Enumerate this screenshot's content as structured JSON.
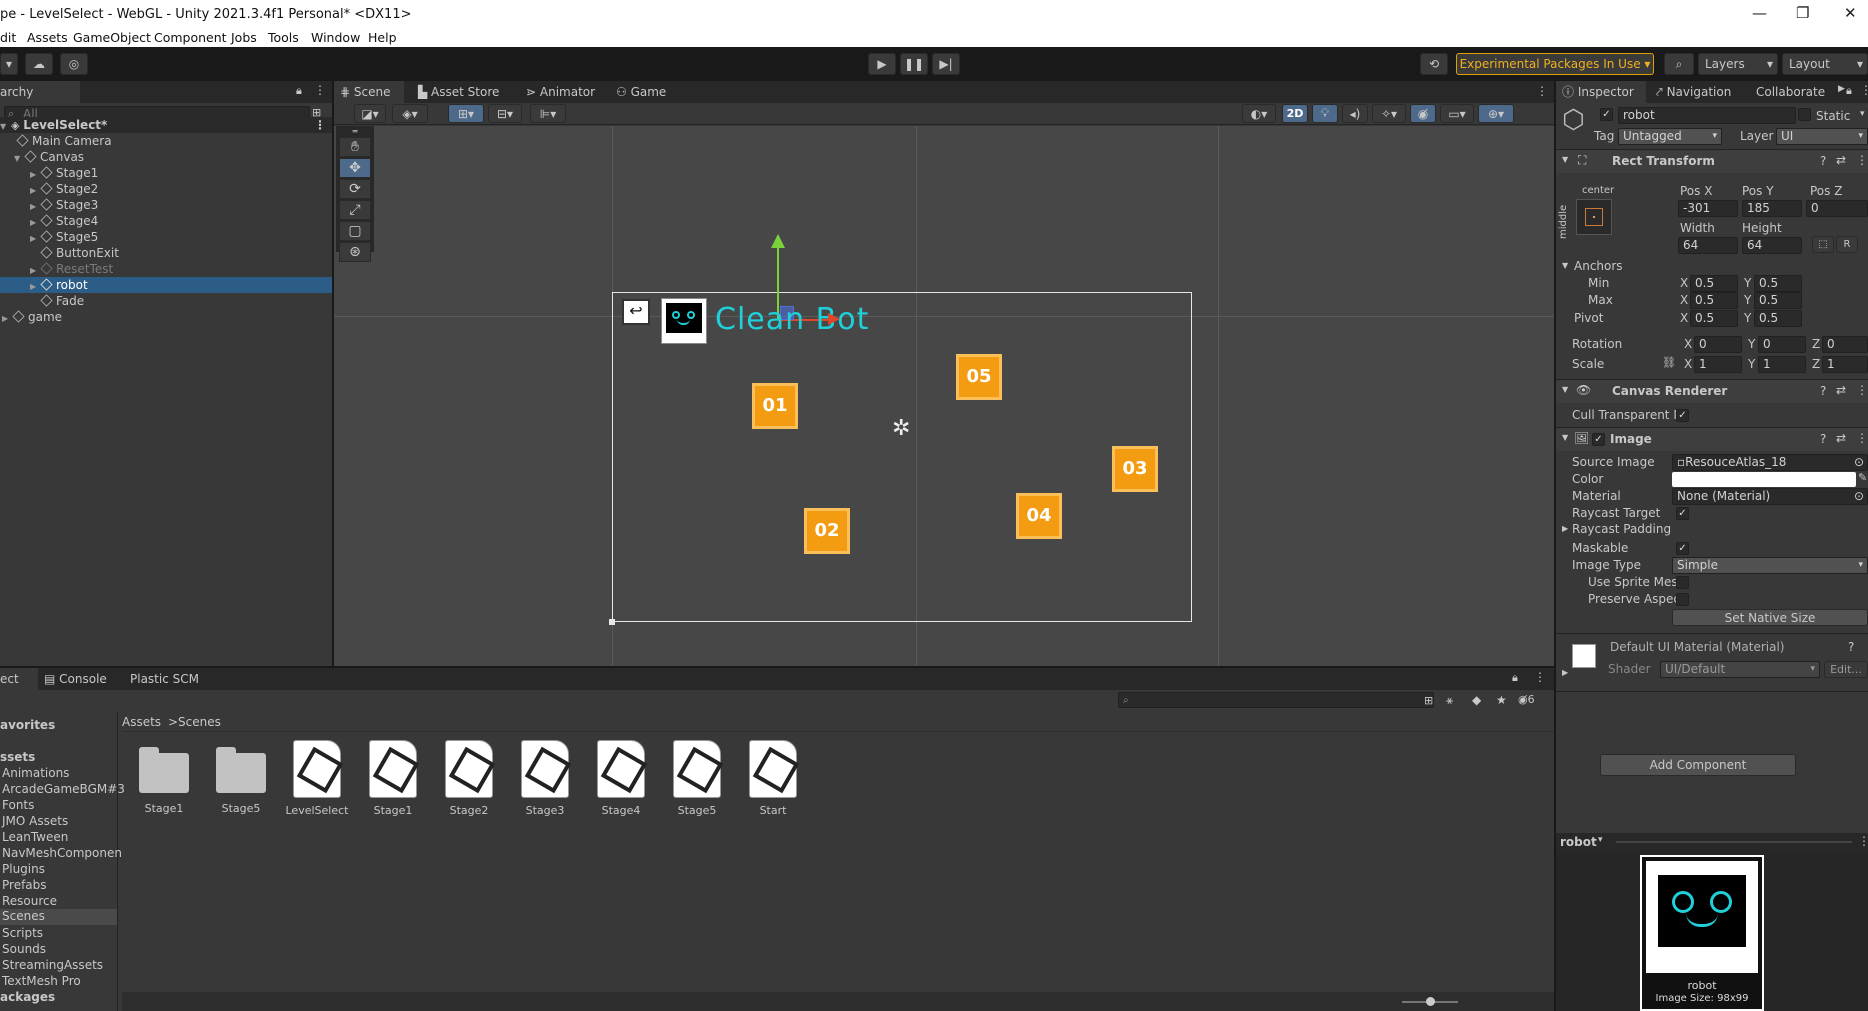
{
  "window": {
    "title": "pe - LevelSelect - WebGL - Unity 2021.3.4f1 Personal* <DX11>",
    "controls": [
      "—",
      "❐",
      "✕"
    ]
  },
  "menu": [
    "dit",
    "Assets",
    "GameObject",
    "Component",
    "Jobs",
    "Tools",
    "Window",
    "Help"
  ],
  "toolbar": {
    "experimental": "Experimental Packages In Use ▾",
    "layers": "Layers",
    "layout": "Layout"
  },
  "hierarchy": {
    "tab": "archy",
    "search_placeholder": "All",
    "scene": "LevelSelect*",
    "items": [
      {
        "label": "Main Camera"
      },
      {
        "label": "Canvas"
      },
      {
        "label": "Stage1"
      },
      {
        "label": "Stage2"
      },
      {
        "label": "Stage3"
      },
      {
        "label": "Stage4"
      },
      {
        "label": "Stage5"
      },
      {
        "label": "ButtonExit"
      },
      {
        "label": "ResetTest"
      },
      {
        "label": "robot"
      },
      {
        "label": "Fade"
      },
      {
        "label": "game"
      }
    ]
  },
  "scene_tabs": [
    "Scene",
    "Asset Store",
    "Animator",
    "Game"
  ],
  "scene_toolbar": {
    "mode_2d": "2D"
  },
  "scene_view": {
    "game_title": "Clean Bot",
    "stages": [
      "01",
      "02",
      "03",
      "04",
      "05"
    ]
  },
  "inspector": {
    "tabs": [
      "Inspector",
      "Navigation",
      "Collaborate"
    ],
    "object_name": "robot",
    "static_label": "Static",
    "tag_label": "Tag",
    "tag_value": "Untagged",
    "layer_label": "Layer",
    "layer_value": "UI",
    "rect_transform": {
      "title": "Rect Transform",
      "anchor_preset_top": "center",
      "anchor_preset_side": "middle",
      "pos_x_label": "Pos X",
      "pos_y_label": "Pos Y",
      "pos_z_label": "Pos Z",
      "pos_x": "-301",
      "pos_y": "185",
      "pos_z": "0",
      "width_label": "Width",
      "height_label": "Height",
      "width": "64",
      "height": "64",
      "anchors_label": "Anchors",
      "min_label": "Min",
      "max_label": "Max",
      "min_x": "0.5",
      "min_y": "0.5",
      "max_x": "0.5",
      "max_y": "0.5",
      "pivot_label": "Pivot",
      "pivot_x": "0.5",
      "pivot_y": "0.5",
      "rotation_label": "Rotation",
      "rot_x": "0",
      "rot_y": "0",
      "rot_z": "0",
      "scale_label": "Scale",
      "scale_x": "1",
      "scale_y": "1",
      "scale_z": "1",
      "x": "X",
      "y": "Y",
      "z": "Z",
      "r_btn": "R"
    },
    "canvas_renderer": {
      "title": "Canvas Renderer",
      "cull_label": "Cull Transparent Mes"
    },
    "image": {
      "title": "Image",
      "source_image_label": "Source Image",
      "source_image": "ResoucеAtlas_18",
      "color_label": "Color",
      "material_label": "Material",
      "material": "None (Material)",
      "raycast_target_label": "Raycast Target",
      "raycast_padding_label": "Raycast Padding",
      "maskable_label": "Maskable",
      "image_type_label": "Image Type",
      "image_type": "Simple",
      "use_sprite_mesh_label": "Use Sprite Mesh",
      "preserve_aspect_label": "Preserve Aspect",
      "set_native_size": "Set Native Size"
    },
    "material": {
      "title": "Default UI Material (Material)",
      "shader_label": "Shader",
      "shader": "UI/Default",
      "edit": "Edit..."
    },
    "add_component": "Add Component",
    "preview": {
      "name": "robot",
      "caption_name": "robot",
      "caption_size": "Image Size: 98x99"
    }
  },
  "project": {
    "tabs": [
      "ect",
      "Console",
      "Plastic SCM"
    ],
    "favorites": "avorites",
    "assets_header": "ssets",
    "folders": [
      "Animations",
      "ArcadeGameBGM#3",
      "Fonts",
      "JMO Assets",
      "LeanTween",
      "NavMeshComponen",
      "Plugins",
      "Prefabs",
      "Resource",
      "Scenes",
      "Scripts",
      "Sounds",
      "StreamingAssets",
      "TextMesh Pro"
    ],
    "packages": "ackages",
    "breadcrumb": [
      "Assets",
      "Scenes"
    ],
    "hidden_count": "6",
    "items": [
      {
        "label": "Stage1",
        "kind": "folder"
      },
      {
        "label": "Stage5",
        "kind": "folder"
      },
      {
        "label": "LevelSelect",
        "kind": "scene"
      },
      {
        "label": "Stage1",
        "kind": "scene"
      },
      {
        "label": "Stage2",
        "kind": "scene"
      },
      {
        "label": "Stage3",
        "kind": "scene"
      },
      {
        "label": "Stage4",
        "kind": "scene"
      },
      {
        "label": "Stage5",
        "kind": "scene"
      },
      {
        "label": "Start",
        "kind": "scene"
      }
    ]
  },
  "colors": {
    "selection": "#2c5d87",
    "accent_orange": "#f39c12",
    "game_title": "#1fd0d8",
    "experimental_border": "#e0a000"
  }
}
